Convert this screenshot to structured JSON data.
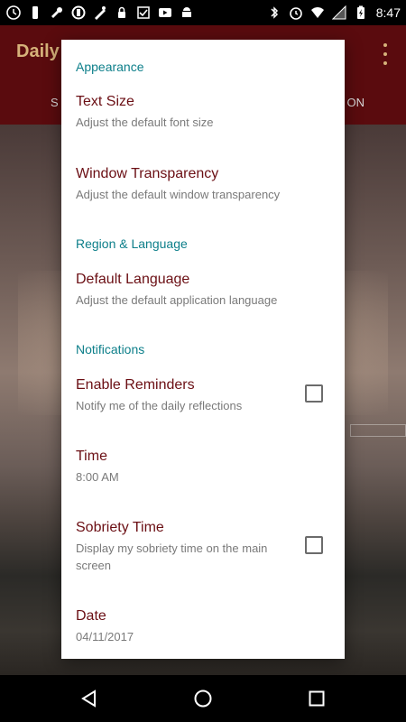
{
  "status_bar": {
    "time": "8:47",
    "left_icons": [
      "clock-icon",
      "phone-icon",
      "wrench-icon",
      "circle-icon",
      "app-icon",
      "lock-icon",
      "check-icon",
      "youtube-icon",
      "android-icon"
    ],
    "right_icons": [
      "bluetooth-icon",
      "alarm-icon",
      "wifi-icon",
      "signal-icon",
      "battery-icon"
    ]
  },
  "app": {
    "title": "Daily",
    "tab_left": "S",
    "tab_right": "ON"
  },
  "dialog": {
    "appearance": {
      "section": "Appearance",
      "text_size_title": "Text Size",
      "text_size_summary": "Adjust the default font size",
      "transparency_title": "Window Transparency",
      "transparency_summary": "Adjust the default window transparency"
    },
    "region": {
      "section": "Region & Language",
      "language_title": "Default Language",
      "language_summary": "Adjust the default application language"
    },
    "notifications": {
      "section": "Notifications",
      "reminders_title": "Enable Reminders",
      "reminders_summary": "Notify me of the daily reflections",
      "time_title": "Time",
      "time_value": "8:00 AM",
      "sobriety_title": "Sobriety Time",
      "sobriety_summary": "Display my sobriety time on the main screen",
      "date_title": "Date",
      "date_value": "04/11/2017"
    }
  },
  "colors": {
    "app_bar": "#5a0b0e",
    "section_text": "#0d7f8a",
    "title_text": "#6b0f14"
  }
}
